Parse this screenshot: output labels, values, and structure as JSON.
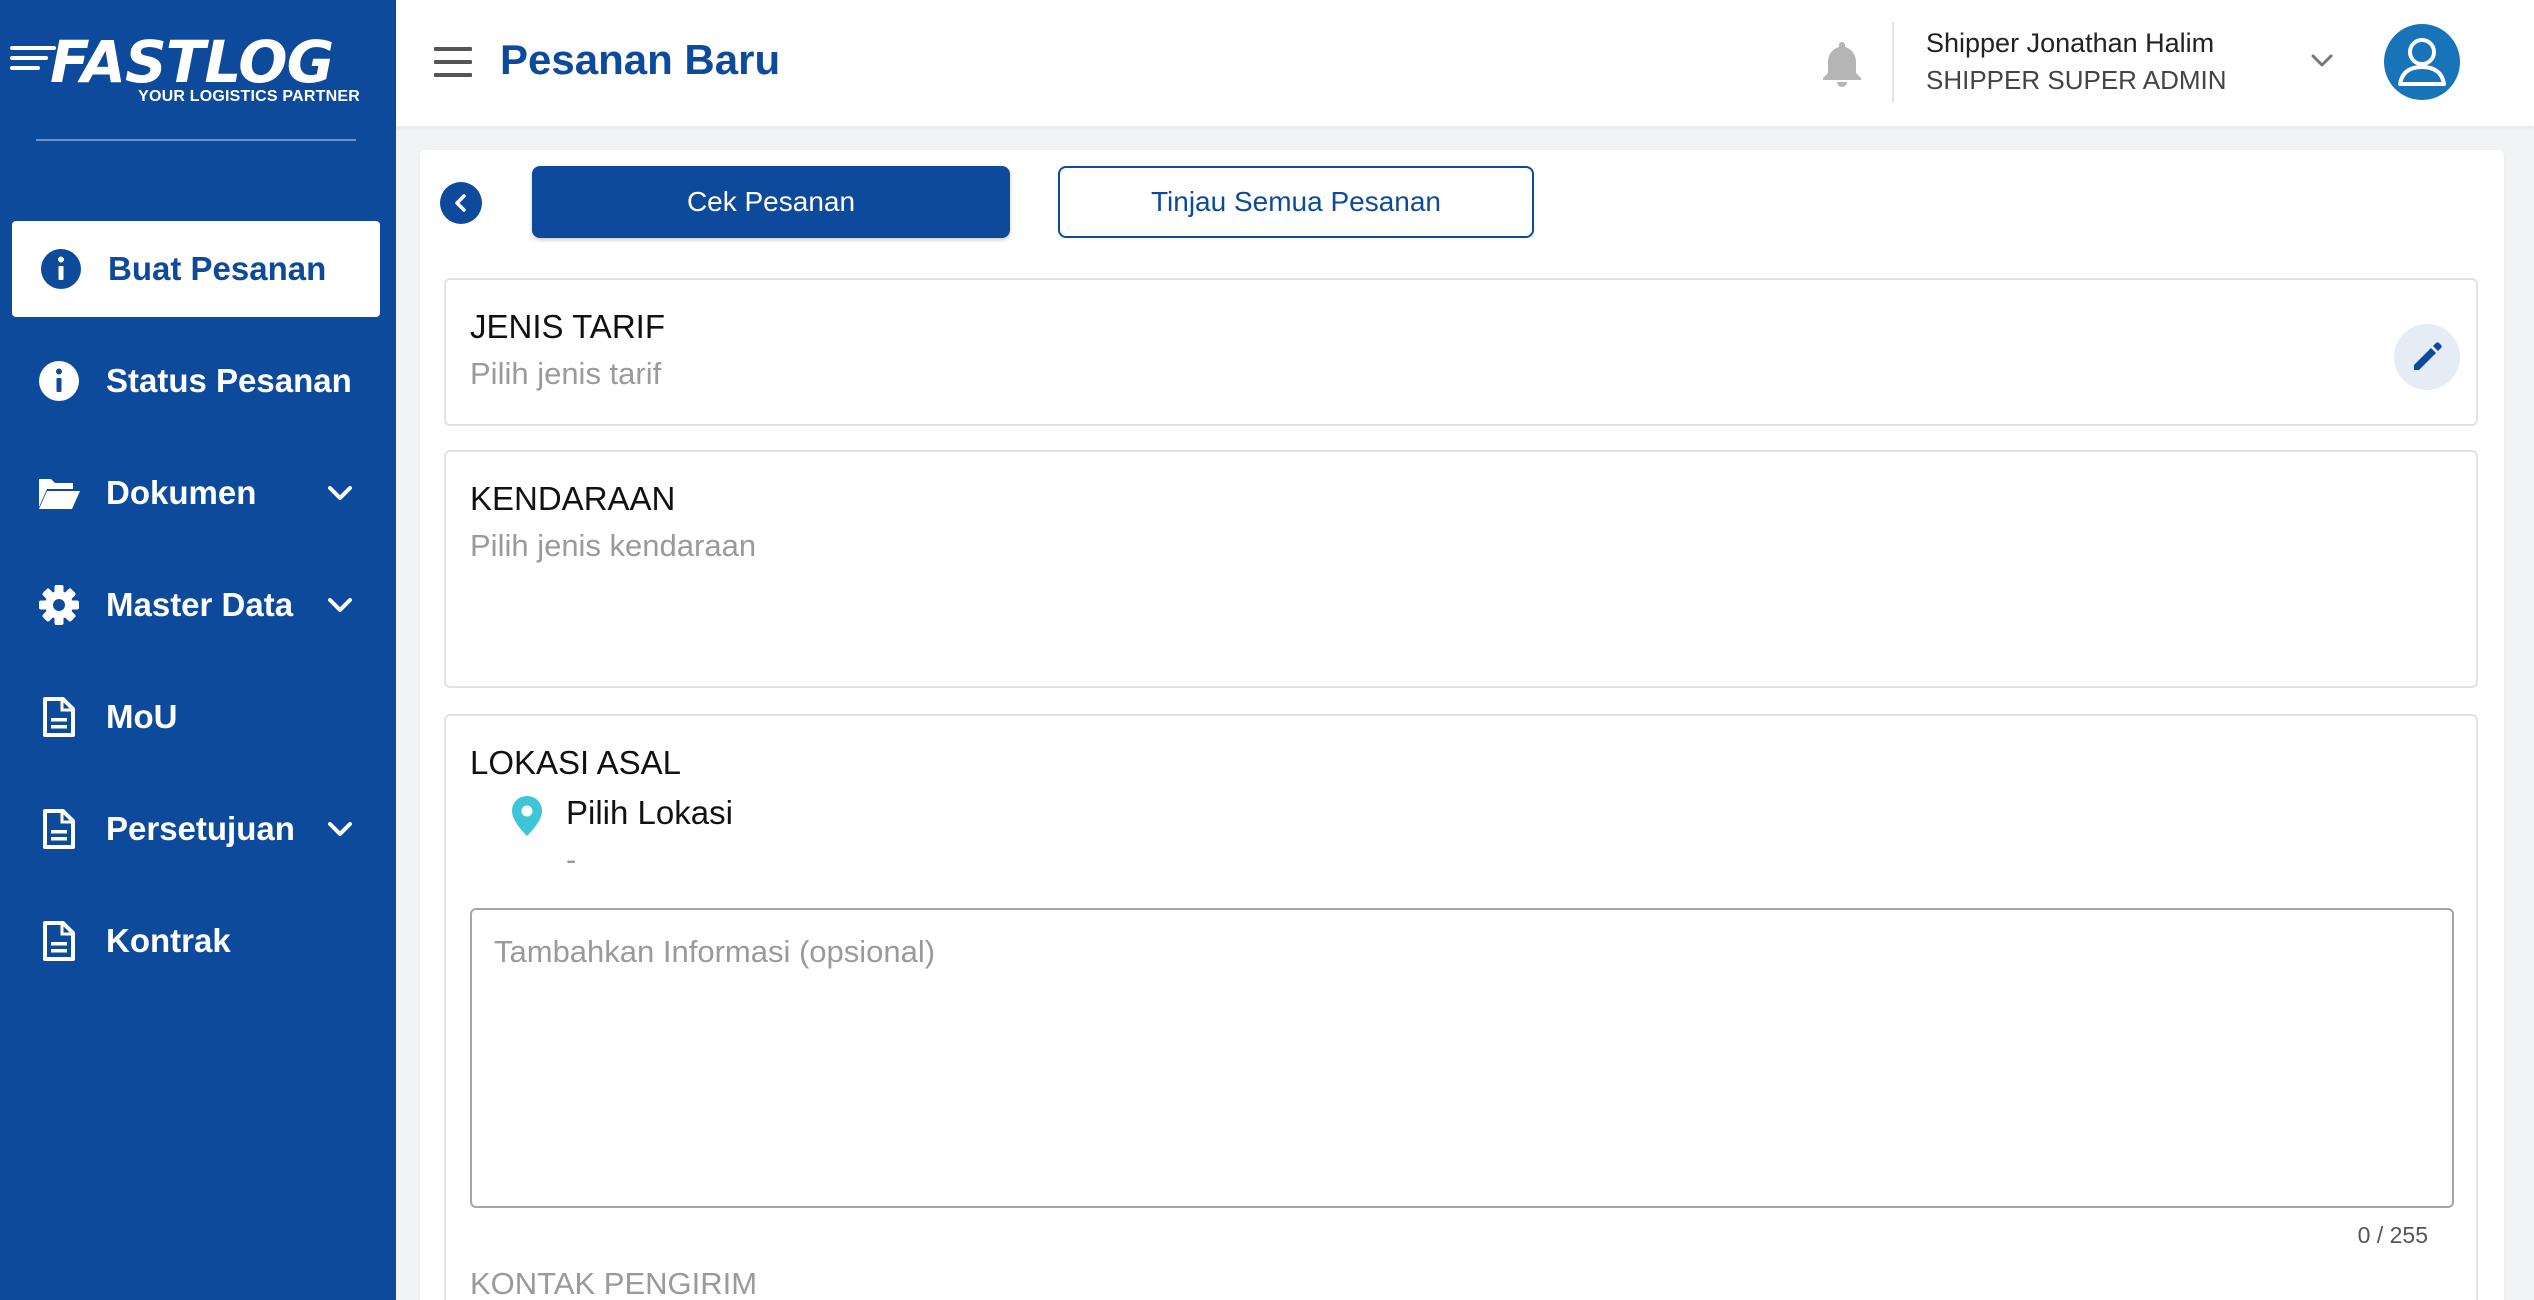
{
  "app": {
    "logo_text": "FASTLOG",
    "logo_tagline": "YOUR LOGISTICS PARTNER"
  },
  "sidebar": {
    "items": [
      {
        "label": "Buat Pesanan",
        "icon": "info-icon",
        "active": true,
        "expandable": false
      },
      {
        "label": "Status Pesanan",
        "icon": "info-icon",
        "active": false,
        "expandable": false
      },
      {
        "label": "Dokumen",
        "icon": "folder-open-icon",
        "active": false,
        "expandable": true
      },
      {
        "label": "Master Data",
        "icon": "gear-icon",
        "active": false,
        "expandable": true
      },
      {
        "label": "MoU",
        "icon": "document-icon",
        "active": false,
        "expandable": false
      },
      {
        "label": "Persetujuan",
        "icon": "document-icon",
        "active": false,
        "expandable": true
      },
      {
        "label": "Kontrak",
        "icon": "document-icon",
        "active": false,
        "expandable": false
      }
    ]
  },
  "header": {
    "title": "Pesanan Baru",
    "user_name": "Shipper Jonathan Halim",
    "user_role": "SHIPPER SUPER ADMIN"
  },
  "toolbar": {
    "check_label": "Cek Pesanan",
    "review_label": "Tinjau Semua Pesanan"
  },
  "tarif": {
    "title": "JENIS TARIF",
    "placeholder": "Pilih jenis tarif"
  },
  "kendaraan": {
    "title": "KENDARAAN",
    "placeholder": "Pilih jenis kendaraan"
  },
  "lokasi_asal": {
    "title": "LOKASI ASAL",
    "location_label": "Pilih Lokasi",
    "location_value": "-",
    "info_placeholder": "Tambahkan Informasi (opsional)",
    "info_value": "",
    "char_counter": "0 / 255",
    "contact_label": "KONTAK PENGIRIM"
  },
  "colors": {
    "primary": "#0d4a9c",
    "accent_pin": "#3ec6d8",
    "avatar": "#1874b8"
  }
}
